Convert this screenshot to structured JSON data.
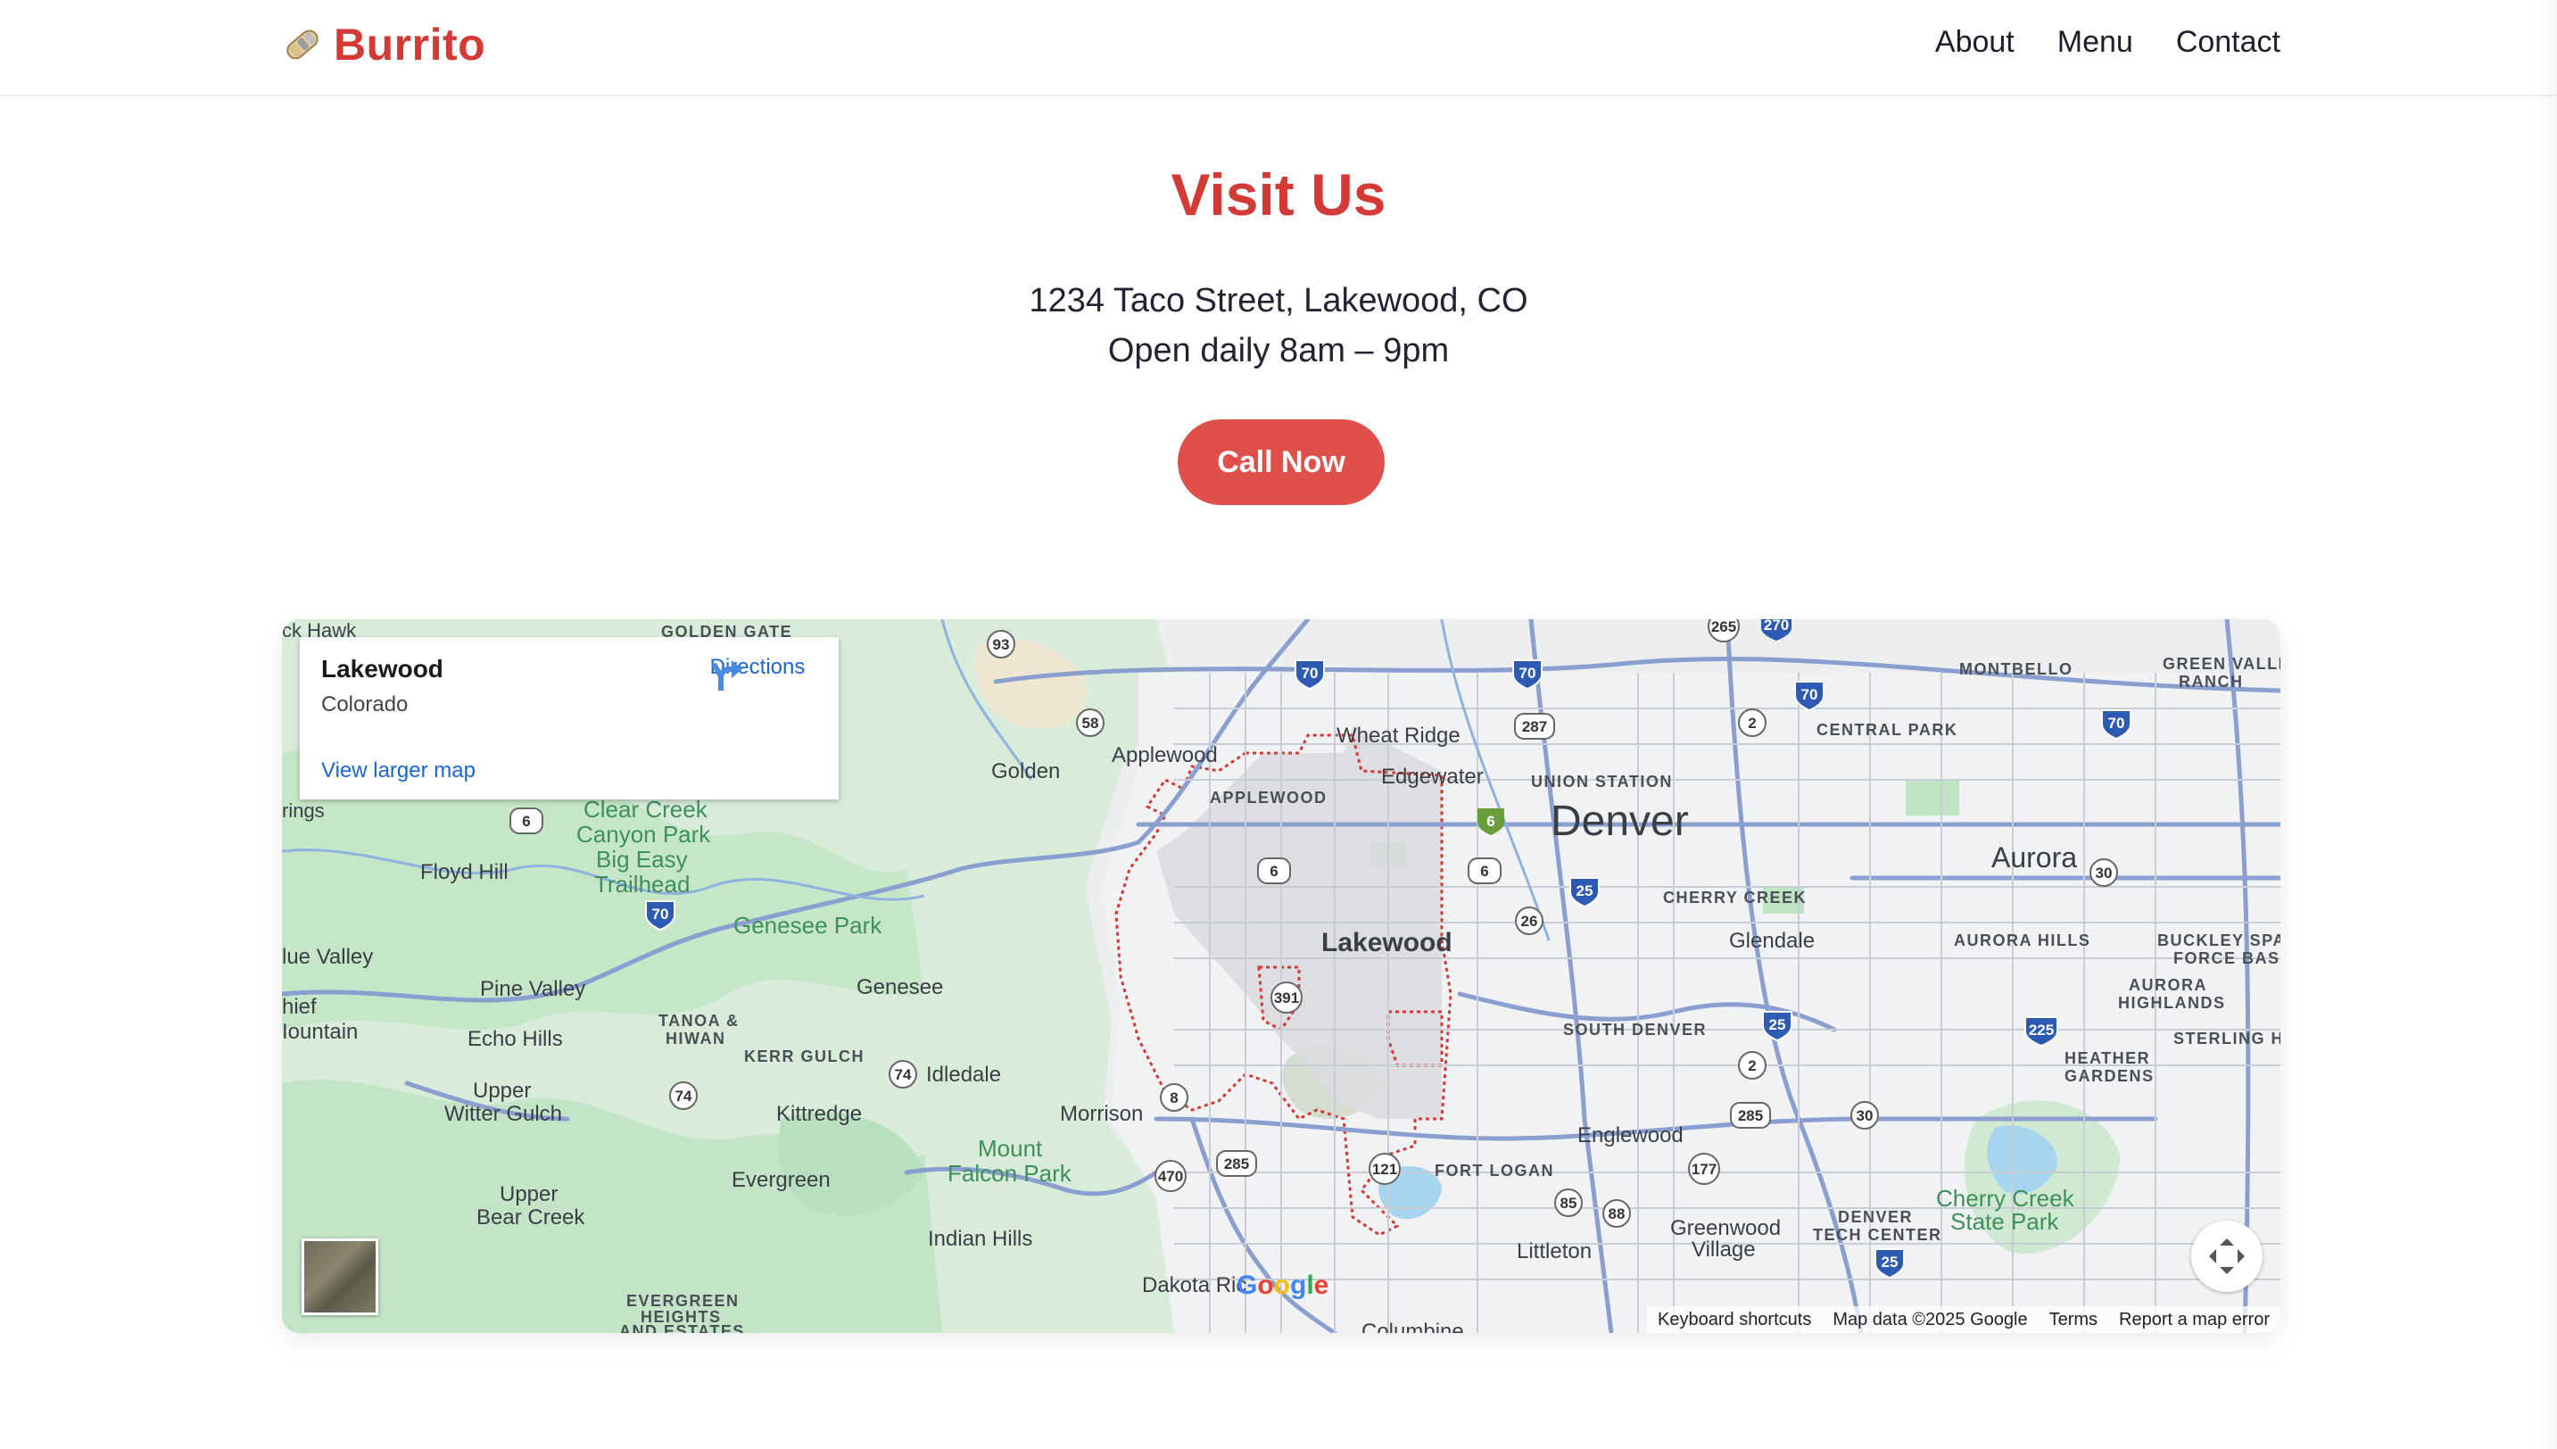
{
  "header": {
    "brand": "Burrito",
    "nav": [
      "About",
      "Menu",
      "Contact"
    ]
  },
  "hero": {
    "title": "Visit Us",
    "address": "1234 Taco Street, Lakewood, CO",
    "hours": "Open daily 8am – 9pm",
    "cta": "Call Now"
  },
  "map": {
    "card": {
      "place": "Lakewood",
      "region": "Colorado",
      "directions": "Directions",
      "larger_map": "View larger map"
    },
    "google": "Google",
    "attribution": [
      "Keyboard shortcuts",
      "Map data ©2025 Google",
      "Terms",
      "Report a map error"
    ],
    "labels": {
      "black_hawk": "ck Hawk",
      "golden_gate": "GOLDEN GATE",
      "springs": "rings",
      "clear_creek": "Clear Creek",
      "canyon_park": "Canyon Park",
      "big_easy": "Big Easy",
      "trailhead": "Trailhead",
      "floyd_hill": "Floyd Hill",
      "golden": "Golden",
      "applewood": "Applewood",
      "applewood_cap": "APPLEWOOD",
      "wheat_ridge": "Wheat Ridge",
      "edgewater": "Edgewater",
      "union_station": "UNION STATION",
      "denver": "Denver",
      "montbello": "MONTBELLO",
      "green_valley_1": "GREEN VALLE",
      "green_valley_2": "RANCH",
      "central_park": "CENTRAL PARK",
      "aurora": "Aurora",
      "cherry_creek": "CHERRY CREEK",
      "glendale": "Glendale",
      "aurora_hills": "AURORA HILLS",
      "buckley_1": "BUCKLEY SPAC",
      "buckley_2": "FORCE BASE",
      "aurora_highlands_1": "AURORA",
      "aurora_highlands_2": "HIGHLANDS",
      "sterling_hill": "STERLING HILL",
      "heather_gardens_1": "HEATHER",
      "heather_gardens_2": "GARDENS",
      "lakewood": "Lakewood",
      "blue_valley": "lue Valley",
      "chief_mountain_1": "hief",
      "chief_mountain_2": "Iountain",
      "pine_valley": "Pine Valley",
      "genesee_park": "Genesee Park",
      "genesee": "Genesee",
      "tanoa_1": "TANOA &",
      "tanoa_2": "HIWAN",
      "kerr_gulch": "KERR GULCH",
      "idledale": "Idledale",
      "echo_hills": "Echo Hills",
      "upper_witter_1": "Upper",
      "upper_witter_2": "Witter Gulch",
      "kittredge": "Kittredge",
      "morrison": "Morrison",
      "mount_falcon_1": "Mount",
      "mount_falcon_2": "Falcon Park",
      "south_denver": "SOUTH DENVER",
      "englewood": "Englewood",
      "fort_logan": "FORT LOGAN",
      "evergreen": "Evergreen",
      "upper_bear_1": "Upper",
      "upper_bear_2": "Bear Creek",
      "indian_hills": "Indian Hills",
      "littleton": "Littleton",
      "greenwood_1": "Greenwood",
      "greenwood_2": "Village",
      "dtc_1": "DENVER",
      "dtc_2": "TECH CENTER",
      "cherry_creek_park_1": "Cherry Creek",
      "cherry_creek_park_2": "State Park",
      "dakota_ridge": "Dakota Ric",
      "evergreen_heights_1": "EVERGREEN",
      "evergreen_heights_2": "HEIGHTS",
      "evergreen_heights_3": "AND ESTATES",
      "columbine": "Columbine"
    },
    "shields": [
      "93",
      "58",
      "6",
      "70",
      "6",
      "287",
      "265",
      "270",
      "70",
      "70",
      "2",
      "70",
      "70",
      "6",
      "6",
      "25",
      "26",
      "30",
      "391",
      "25",
      "225",
      "2",
      "74",
      "74",
      "8",
      "285",
      "30",
      "285",
      "121",
      "177",
      "470",
      "85",
      "88",
      "25"
    ]
  },
  "colors": {
    "brand": "#d43a35",
    "cta": "#e0504a",
    "link": "#1a66d2"
  }
}
